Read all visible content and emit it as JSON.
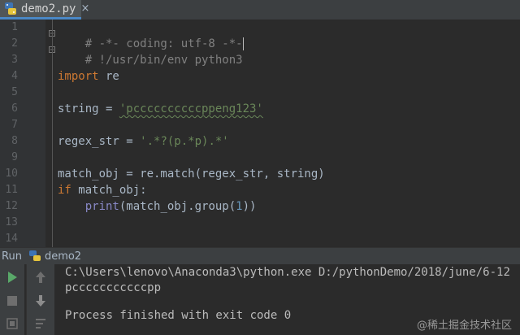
{
  "tab": {
    "file_name": "demo2.py",
    "close_glyph": "×",
    "icon": "python-file-icon"
  },
  "editor": {
    "line_numbers": [
      "1",
      "2",
      "3",
      "4",
      "5",
      "6",
      "7",
      "8",
      "9",
      "10",
      "11",
      "12",
      "13",
      "14"
    ],
    "lines": {
      "l1": "# -*- coding: utf-8 -*-",
      "l2": "# !/usr/bin/env python3",
      "l4_kw": "import",
      "l4_rest": " re",
      "l6_lhs": "string = ",
      "l6_str": "'pccccccccccppeng123'",
      "l8_lhs": "regex_str = ",
      "l8_str": "'.*?(p.*p).*'",
      "l10": "match_obj = re.match(regex_str, string)",
      "l11_kw": "if",
      "l11_rest": " match_obj:",
      "l12_indent": "    ",
      "l12_bi": "print",
      "l12_a": "(match_obj.group(",
      "l12_num": "1",
      "l12_b": "))"
    }
  },
  "run": {
    "label": "Run",
    "config_name": "demo2",
    "output": [
      "C:\\Users\\lenovo\\Anaconda3\\python.exe D:/pythonDemo/2018/june/6-12",
      "pcccccccccccpp",
      "",
      "Process finished with exit code 0"
    ]
  },
  "watermark": "@稀土掘金技术社区",
  "colors": {
    "keyword": "#cc7832",
    "string": "#6a8759",
    "comment": "#808080",
    "number": "#6897bb",
    "builtin": "#8888c6",
    "run_green": "#59a869"
  }
}
